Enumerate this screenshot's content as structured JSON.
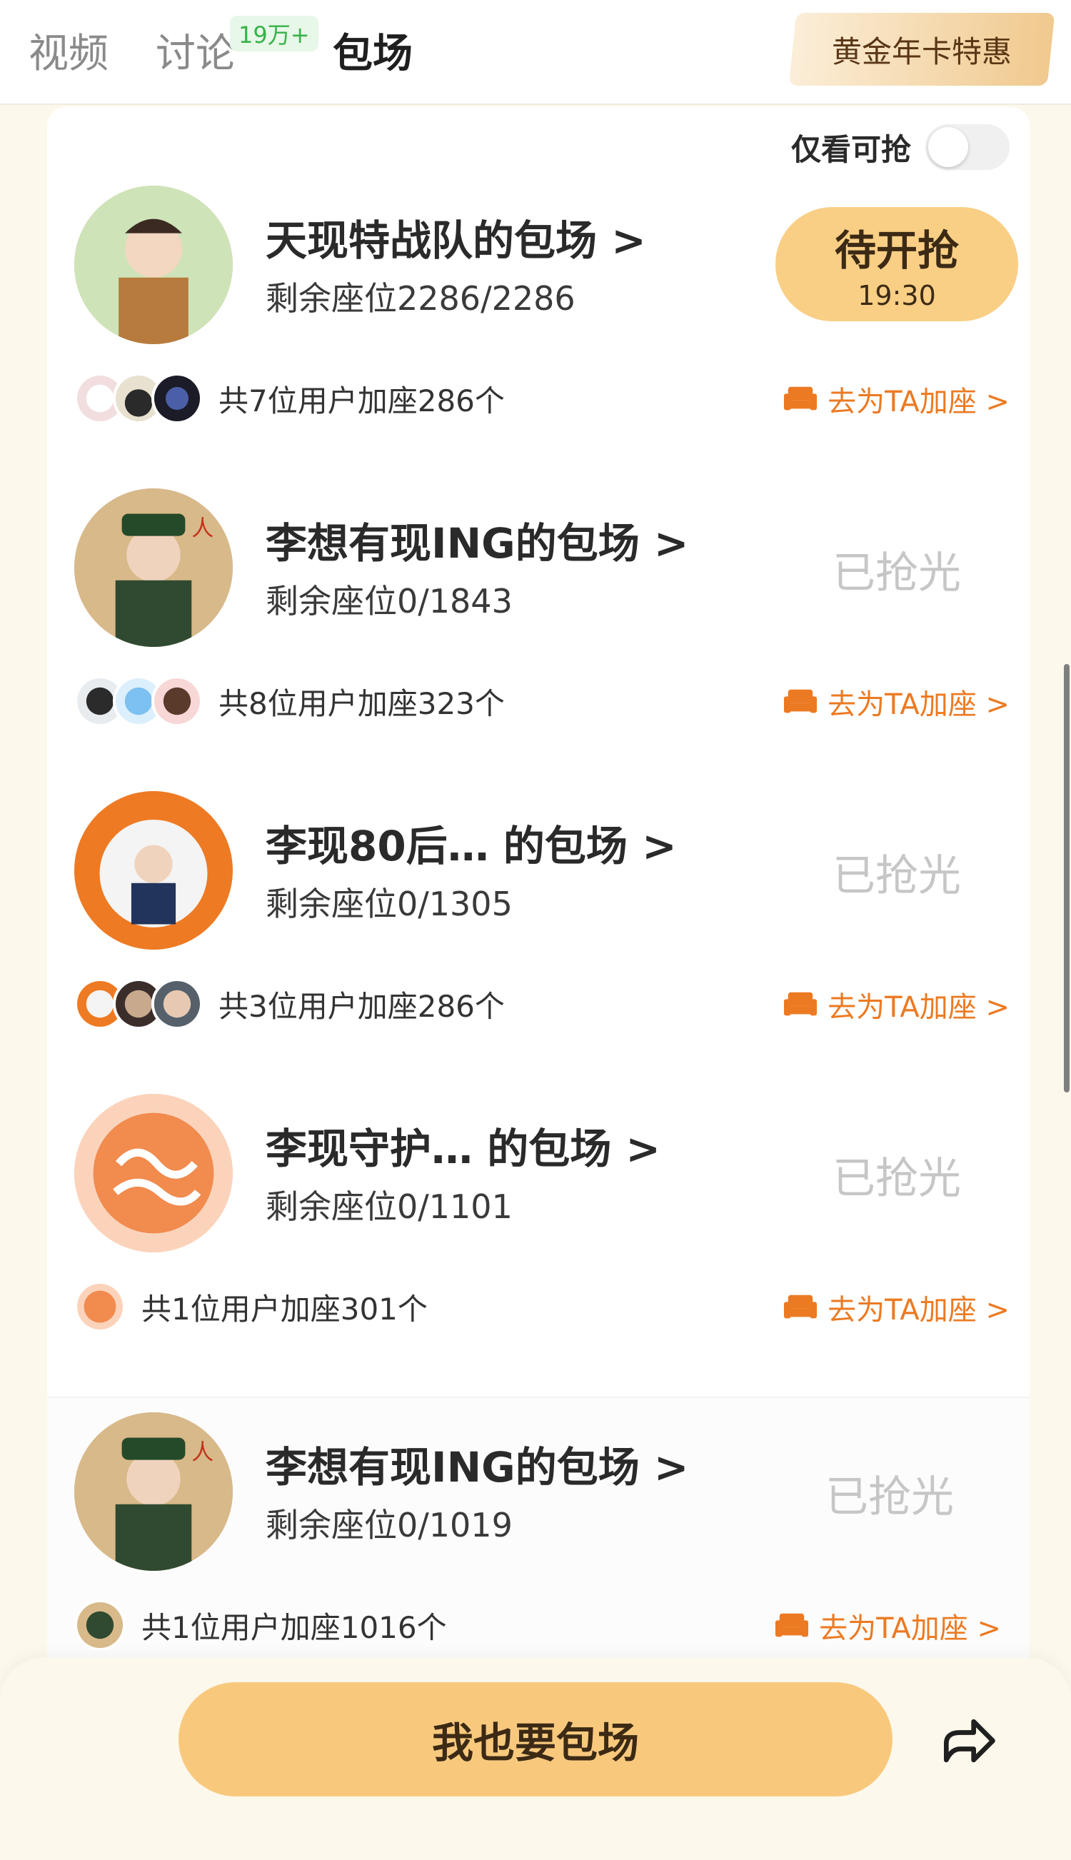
{
  "tabs": {
    "video": "视频",
    "discuss": "讨论",
    "discuss_badge": "19万+",
    "boxing": "包场"
  },
  "promo": "黄金年卡特惠",
  "filter": {
    "label": "仅看可抢",
    "enabled": false
  },
  "items": [
    {
      "title": "天现特战队的包场 >",
      "seats": "剩余座位2286/2286",
      "status": "待开抢",
      "status_time": "19:30",
      "users": "共7位用户加座286个",
      "link": "去为TA加座 >"
    },
    {
      "title": "李想有现ING的包场 >",
      "seats": "剩余座位0/1843",
      "status": "已抢光",
      "users": "共8位用户加座323个",
      "link": "去为TA加座 >"
    },
    {
      "title": "李现80后… 的包场 >",
      "seats": "剩余座位0/1305",
      "status": "已抢光",
      "users": "共3位用户加座286个",
      "link": "去为TA加座 >"
    },
    {
      "title": "李现守护…  的包场 >",
      "seats": "剩余座位0/1101",
      "status": "已抢光",
      "users": "共1位用户加座301个",
      "link": "去为TA加座 >"
    },
    {
      "title": "李想有现ING的包场 >",
      "seats": "剩余座位0/1019",
      "status": "已抢光",
      "users": "共1位用户加座1016个",
      "link": "去为TA加座 >"
    }
  ],
  "bottom": {
    "button": "我也要包场"
  },
  "colors": {
    "accent": "#ec7a22",
    "button": "#f8c97d",
    "soldout": "#c6c6c6"
  }
}
